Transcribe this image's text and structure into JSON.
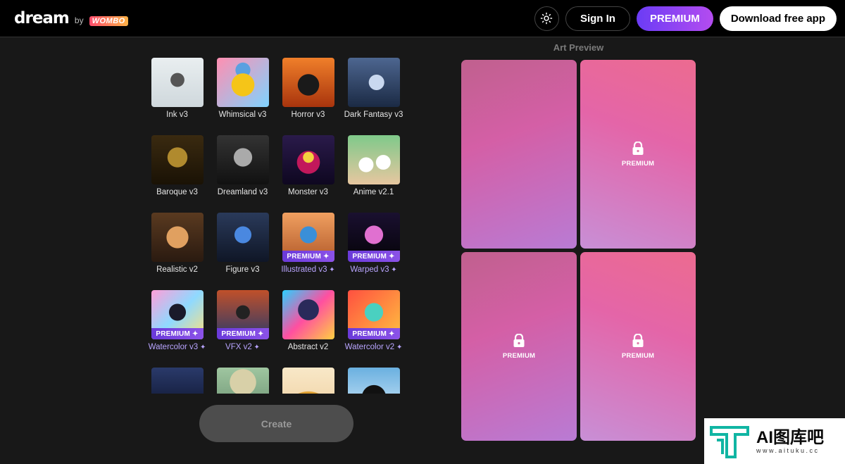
{
  "header": {
    "logo_text": "dream",
    "logo_by": "by",
    "logo_wombo": "WOMBO",
    "signin_label": "Sign In",
    "premium_label": "PREMIUM",
    "download_label": "Download free app"
  },
  "styles": {
    "items": [
      {
        "label": "Ink v3",
        "premium": false
      },
      {
        "label": "Whimsical v3",
        "premium": false
      },
      {
        "label": "Horror v3",
        "premium": false
      },
      {
        "label": "Dark Fantasy v3",
        "premium": false
      },
      {
        "label": "Baroque v3",
        "premium": false
      },
      {
        "label": "Dreamland v3",
        "premium": false
      },
      {
        "label": "Monster v3",
        "premium": false
      },
      {
        "label": "Anime v2.1",
        "premium": false
      },
      {
        "label": "Realistic v2",
        "premium": false
      },
      {
        "label": "Figure v3",
        "premium": false
      },
      {
        "label": "Illustrated v3",
        "premium": true
      },
      {
        "label": "Warped v3",
        "premium": true
      },
      {
        "label": "Watercolor v3",
        "premium": true
      },
      {
        "label": "VFX v2",
        "premium": true
      },
      {
        "label": "Abstract v2",
        "premium": false
      },
      {
        "label": "Watercolor v2",
        "premium": true
      },
      {
        "label": "",
        "premium": false
      },
      {
        "label": "",
        "premium": false
      },
      {
        "label": "",
        "premium": false
      },
      {
        "label": "",
        "premium": false
      }
    ],
    "premium_tag": "PREMIUM",
    "sparkle": "✦"
  },
  "create_label": "Create",
  "preview": {
    "title": "Art Preview",
    "locked_label": "PREMIUM"
  },
  "watermark": {
    "main": "AI图库吧",
    "sub": "www.aituku.cc"
  },
  "colors": {
    "accent": "#7a45f3",
    "premium_label": "#b9a5ff"
  }
}
